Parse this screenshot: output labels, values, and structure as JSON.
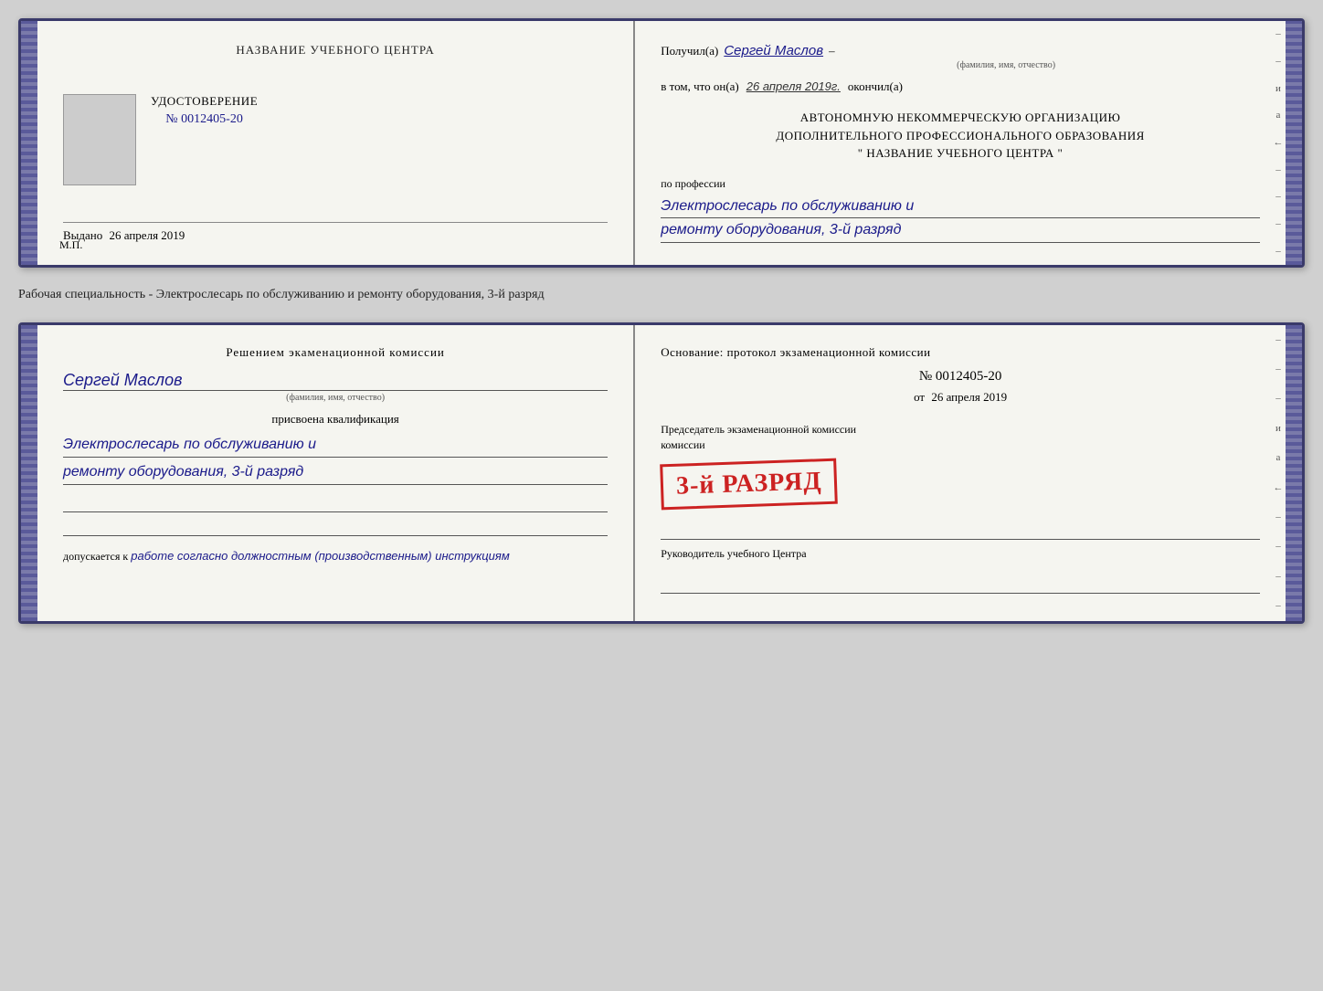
{
  "top_document": {
    "left": {
      "heading": "НАЗВАНИЕ УЧЕБНОГО ЦЕНТРА",
      "udost_title": "УДОСТОВЕРЕНИЕ",
      "udost_number": "№ 0012405-20",
      "issued_label": "Выдано",
      "issued_date": "26 апреля 2019",
      "mp_label": "М.П."
    },
    "right": {
      "received_prefix": "Получил(а)",
      "recipient_name": "Сергей Маслов",
      "fio_label": "(фамилия, имя, отчество)",
      "dash": "–",
      "in_that_prefix": "в том, что он(а)",
      "date_handwritten": "26 апреля 2019г.",
      "completed_label": "окончил(а)",
      "org_line1": "АВТОНОМНУЮ НЕКОММЕРЧЕСКУЮ ОРГАНИЗАЦИЮ",
      "org_line2": "ДОПОЛНИТЕЛЬНОГО ПРОФЕССИОНАЛЬНОГО ОБРАЗОВАНИЯ",
      "org_line3": "\" НАЗВАНИЕ УЧЕБНОГО ЦЕНТРА \"",
      "profession_label": "по профессии",
      "profession_line1": "Электрослесарь по обслуживанию и",
      "profession_line2": "ремонту оборудования, 3-й разряд"
    }
  },
  "between_label": "Рабочая специальность - Электрослесарь по обслуживанию и ремонту оборудования, 3-й разряд",
  "bottom_document": {
    "left": {
      "commission_heading": "Решением экаменационной комиссии",
      "person_name": "Сергей Маслов",
      "fio_label": "(фамилия, имя, отчество)",
      "assigned_text": "присвоена квалификация",
      "qualification_line1": "Электрослесарь по обслуживанию и",
      "qualification_line2": "ремонту оборудования, 3-й разряд",
      "allowed_prefix": "допускается к",
      "allowed_handwritten": "работе согласно должностным (производственным) инструкциям"
    },
    "right": {
      "basis_text": "Основание: протокол экзаменационной комиссии",
      "protocol_number": "№ 0012405-20",
      "date_prefix": "от",
      "protocol_date": "26 апреля 2019",
      "stamp_text": "3-й РАЗРЯД",
      "chairman_label": "Председатель экзаменационной комиссии",
      "head_label": "Руководитель учебного Центра"
    }
  }
}
